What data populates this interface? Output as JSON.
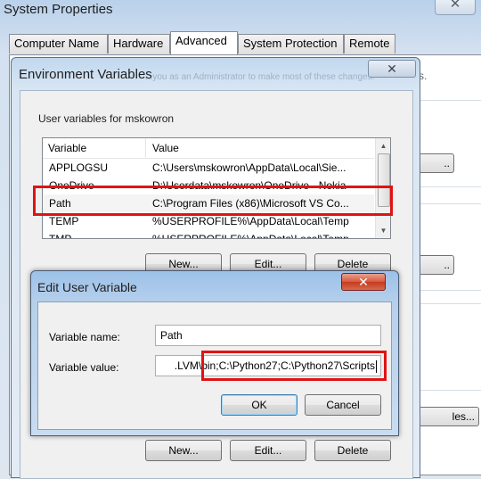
{
  "system_properties": {
    "title": "System Properties",
    "close_glyph": "✕",
    "tabs": [
      "Computer Name",
      "Hardware",
      "Advanced",
      "System Protection",
      "Remote"
    ],
    "active_tab": "Advanced",
    "right_edge_fragments": {
      "text_s": "s.",
      "btn1": "..",
      "btn2": "..",
      "btn3": "les..."
    }
  },
  "environment_variables": {
    "title": "Environment Variables",
    "title_ghost_text": "...you as an Administrator to make most of these changes.",
    "close_glyph": "✕",
    "user_group_label": "User variables for mskowron",
    "columns": [
      "Variable",
      "Value"
    ],
    "rows": [
      {
        "variable": "APPLOGSU",
        "value": "C:\\Users\\mskowron\\AppData\\Local\\Sie..."
      },
      {
        "variable": "OneDrive",
        "value": "D:\\Userdata\\mskowron\\OneDrive - Nokia"
      },
      {
        "variable": "Path",
        "value": "C:\\Program Files (x86)\\Microsoft VS Co..."
      },
      {
        "variable": "TEMP",
        "value": "%USERPROFILE%\\AppData\\Local\\Temp"
      },
      {
        "variable": "TMP",
        "value": "%USERPROFILE%\\AppData\\Local\\Temp"
      }
    ],
    "selected_row": "Path",
    "buttons": {
      "new": "New...",
      "edit": "Edit...",
      "delete": "Delete"
    },
    "bottom_buttons": {
      "new": "New...",
      "edit": "Edit...",
      "delete": "Delete"
    }
  },
  "edit_user_variable": {
    "title": "Edit User Variable",
    "close_glyph": "✕",
    "name_label": "Variable name:",
    "name_value": "Path",
    "value_label": "Variable value:",
    "value_visible_prefix": ".LVM\\bin;",
    "value_visible_suffix": "C:\\Python27;C:\\Python27\\Scripts",
    "ok_label": "OK",
    "cancel_label": "Cancel"
  },
  "highlights": {
    "color": "#e01313"
  }
}
